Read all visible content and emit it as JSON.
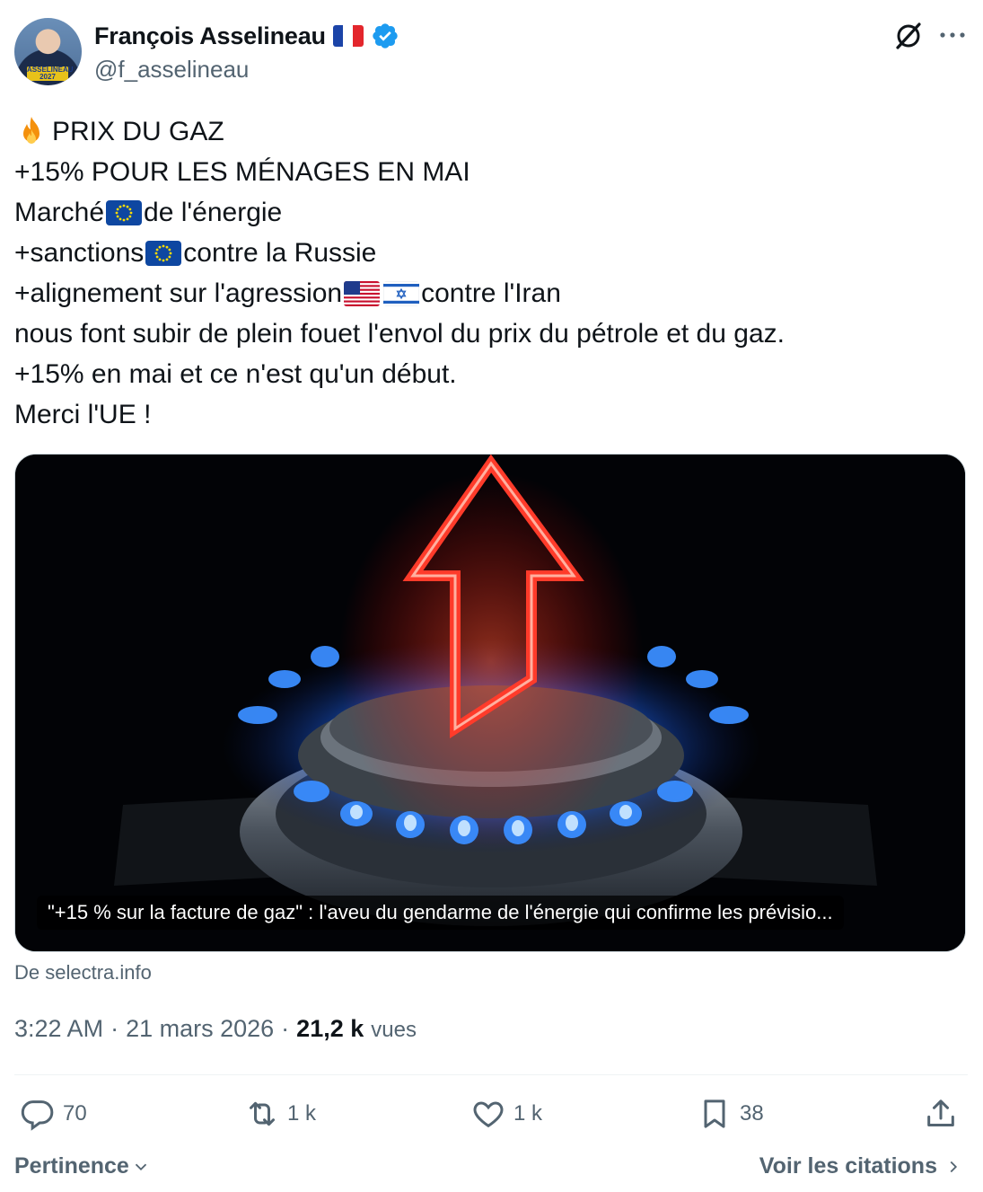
{
  "author": {
    "display_name": "François Asselineau",
    "handle": "@f_asselineau",
    "avatar_badge": "ASSELINEAU 2027",
    "verified": true
  },
  "tweet": {
    "lines": [
      "PRIX DU GAZ",
      "+15% POUR LES MÉNAGES EN MAI",
      "Marché",
      "de l'énergie",
      "+sanctions",
      "contre la Russie",
      "+alignement sur l'agression",
      "contre l'Iran",
      "nous font subir de plein fouet l'envol du prix du pétrole et du gaz.",
      "+15% en mai et ce n'est qu'un début.",
      "Merci l'UE !"
    ]
  },
  "card": {
    "caption": "\"+15 % sur la facture de gaz\" : l'aveu du gendarme de l'énergie qui confirme les prévisio...",
    "source": "De selectra.info"
  },
  "meta": {
    "time": "3:22 AM",
    "separator": "·",
    "date": "21 mars 2026",
    "views_count": "21,2 k",
    "views_label": "vues"
  },
  "actions": {
    "replies": "70",
    "reposts": "1 k",
    "likes": "1 k",
    "bookmarks": "38"
  },
  "footer": {
    "sort_label": "Pertinence",
    "quotes_label": "Voir les citations"
  },
  "colors": {
    "text": "#0f1419",
    "secondary": "#536471",
    "verified_blue": "#1d9bf0",
    "divider": "#eff3f4"
  }
}
